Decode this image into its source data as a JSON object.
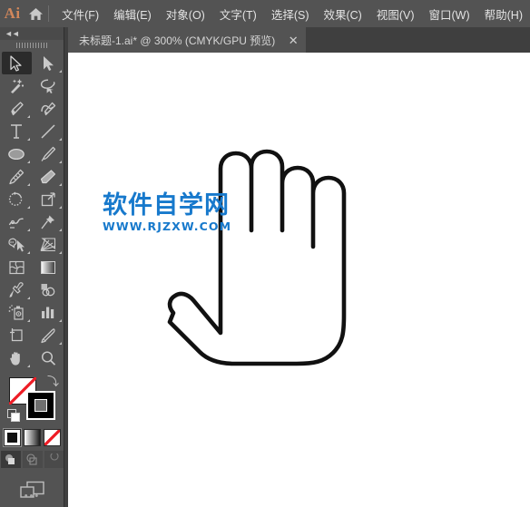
{
  "app": {
    "logo_text": "Ai",
    "home_icon": "home-icon",
    "background_color": "#535353",
    "accent_color": "#d2875b"
  },
  "menubar": {
    "items": [
      {
        "label": "文件(F)",
        "name": "menu-file"
      },
      {
        "label": "编辑(E)",
        "name": "menu-edit"
      },
      {
        "label": "对象(O)",
        "name": "menu-object"
      },
      {
        "label": "文字(T)",
        "name": "menu-type"
      },
      {
        "label": "选择(S)",
        "name": "menu-select"
      },
      {
        "label": "效果(C)",
        "name": "menu-effect"
      },
      {
        "label": "视图(V)",
        "name": "menu-view"
      },
      {
        "label": "窗口(W)",
        "name": "menu-window"
      },
      {
        "label": "帮助(H)",
        "name": "menu-help"
      }
    ]
  },
  "tabbar": {
    "tab_title": "未标题-1.ai* @ 300% (CMYK/GPU 预览)",
    "close_label": "✕",
    "zoom_level": "300%",
    "color_mode": "CMYK",
    "preview_mode": "GPU 预览"
  },
  "toolpanel": {
    "collapse_icon": "◄◄",
    "grip": "drag-grip",
    "edit_toolbar_dots": "•••",
    "tools": [
      {
        "name": "selection-tool",
        "icon": "arrow-solid",
        "active": true,
        "corner": false
      },
      {
        "name": "direct-selection-tool",
        "icon": "arrow-hollow",
        "active": false,
        "corner": true
      },
      {
        "name": "magic-wand-tool",
        "icon": "magic-wand",
        "active": false,
        "corner": false
      },
      {
        "name": "lasso-tool",
        "icon": "lasso",
        "active": false,
        "corner": false
      },
      {
        "name": "pen-tool",
        "icon": "pen",
        "active": false,
        "corner": true
      },
      {
        "name": "curvature-tool",
        "icon": "curvature",
        "active": false,
        "corner": false
      },
      {
        "name": "type-tool",
        "icon": "type-t",
        "active": false,
        "corner": true
      },
      {
        "name": "line-segment-tool",
        "icon": "line-segment",
        "active": false,
        "corner": true
      },
      {
        "name": "ellipse-tool",
        "icon": "ellipse",
        "active": false,
        "corner": true
      },
      {
        "name": "paintbrush-tool",
        "icon": "paintbrush",
        "active": false,
        "corner": true
      },
      {
        "name": "shaper-pencil-tool",
        "icon": "pencil",
        "active": false,
        "corner": true
      },
      {
        "name": "eraser-tool",
        "icon": "eraser",
        "active": false,
        "corner": true
      },
      {
        "name": "rotate-tool",
        "icon": "rotate",
        "active": false,
        "corner": true
      },
      {
        "name": "scale-tool",
        "icon": "scale",
        "active": false,
        "corner": true
      },
      {
        "name": "width-tool",
        "icon": "width-warp",
        "active": false,
        "corner": true
      },
      {
        "name": "free-transform-tool",
        "icon": "pushpin",
        "active": false,
        "corner": true
      },
      {
        "name": "shape-builder-tool",
        "icon": "shape-builder",
        "active": false,
        "corner": true
      },
      {
        "name": "perspective-grid-tool",
        "icon": "perspective-grid",
        "active": false,
        "corner": true
      },
      {
        "name": "mesh-tool",
        "icon": "mesh",
        "active": false,
        "corner": false
      },
      {
        "name": "gradient-tool",
        "icon": "gradient",
        "active": false,
        "corner": false
      },
      {
        "name": "eyedropper-tool",
        "icon": "eyedropper",
        "active": false,
        "corner": true
      },
      {
        "name": "blend-tool",
        "icon": "blend",
        "active": false,
        "corner": false
      },
      {
        "name": "symbol-sprayer-tool",
        "icon": "symbol-sprayer",
        "active": false,
        "corner": true
      },
      {
        "name": "column-graph-tool",
        "icon": "bar-chart",
        "active": false,
        "corner": true
      },
      {
        "name": "artboard-tool",
        "icon": "artboard",
        "active": false,
        "corner": false
      },
      {
        "name": "slice-tool",
        "icon": "slice-knife",
        "active": false,
        "corner": true
      },
      {
        "name": "hand-tool",
        "icon": "hand",
        "active": false,
        "corner": true
      },
      {
        "name": "zoom-tool",
        "icon": "magnifier",
        "active": false,
        "corner": false
      }
    ],
    "fill_stroke": {
      "fill_value": "无 (None)",
      "fill_color": "#ffffff",
      "stroke_value": "黑色",
      "stroke_color": "#000000",
      "swap_icon": "swap-arrow-icon",
      "default_icon": "default-fill-stroke-icon"
    },
    "color_modes": [
      {
        "name": "color-mode-color",
        "label": "颜色",
        "selected": true
      },
      {
        "name": "color-mode-gradient",
        "label": "渐变",
        "selected": false
      },
      {
        "name": "color-mode-none",
        "label": "无",
        "selected": false
      }
    ],
    "draw_modes": [
      {
        "name": "draw-normal",
        "label": "正常绘图",
        "selected": true
      },
      {
        "name": "draw-behind",
        "label": "背面绘图",
        "selected": false
      },
      {
        "name": "draw-inside",
        "label": "内部绘图",
        "selected": false
      }
    ],
    "screen_mode": {
      "name": "screen-mode-button",
      "label": "更改屏幕模式"
    }
  },
  "canvas": {
    "background_color": "#ffffff",
    "artwork": {
      "name": "hand-palm-outline",
      "description": "手掌轮廓路径",
      "stroke_color": "#1a1a1a",
      "fill_color": "none"
    },
    "watermark": {
      "line1": "软件自学网",
      "line2": "WWW.RJZXW.COM",
      "color": "#1779cc"
    }
  }
}
